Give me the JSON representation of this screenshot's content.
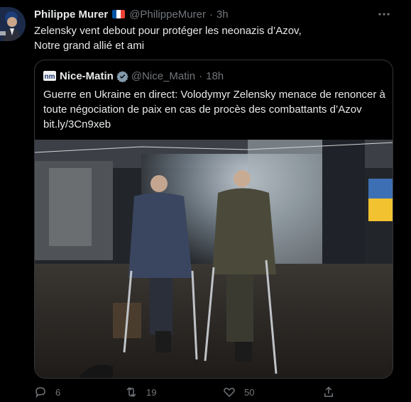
{
  "tweet": {
    "author_name": "Philippe Murer",
    "author_handle": "@PhilippeMurer",
    "separator": "·",
    "time": "3h",
    "text_line1": "Zelensky vent debout pour protéger les neonazis d’Azov,",
    "text_line2": "Notre grand allié et ami",
    "flag_colors": [
      "#0055a4",
      "#ffffff",
      "#ef4135"
    ],
    "avatar_icon": "person-avatar",
    "more_icon": "ellipsis-icon"
  },
  "quote": {
    "logo_text": "nm",
    "author_name": "Nice-Matin",
    "author_handle": "@Nice_Matin",
    "separator": "·",
    "time": "18h",
    "text_line1": "Guerre en Ukraine en direct: Volodymyr Zelensky menace de renoncer à",
    "text_line2": "toute négociation de paix en cas de procès des combattants d’Azov",
    "link": "bit.ly/3Cn9xeb",
    "verified_icon": "verified-badge-icon",
    "image_description_icon": "photo"
  },
  "actions": {
    "reply_count": "6",
    "retweet_count": "19",
    "like_count": "50",
    "reply_icon": "reply-icon",
    "retweet_icon": "retweet-icon",
    "like_icon": "heart-icon",
    "share_icon": "share-icon"
  },
  "colors": {
    "background": "#000000",
    "text": "#e7e9ea",
    "muted": "#71767b",
    "border": "#333639",
    "verified": "#829aab"
  }
}
